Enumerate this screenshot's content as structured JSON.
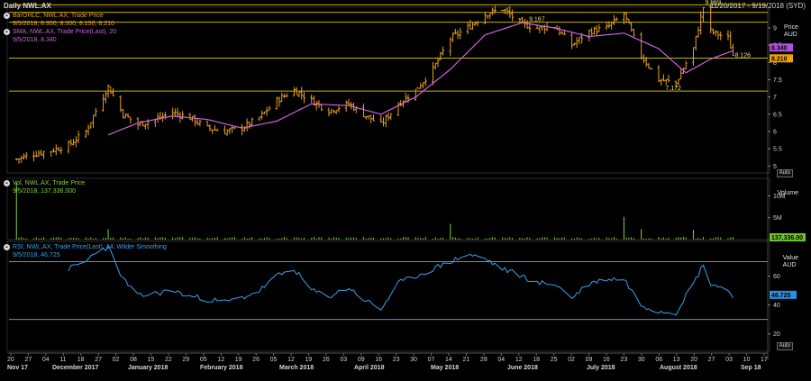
{
  "header": {
    "title": "Daily NWL.AX",
    "range": "11/20/2017 - 9/19/2018 (SYD)"
  },
  "legend": {
    "bar": {
      "name": "BarOHLC, NWL.AX, Trade Price",
      "values": "9/5/2018, 8.350, 8.500, 8.150, 8.210"
    },
    "sma": {
      "name": "SMA, NWL.AX, Trade Price(Last), 20",
      "values": "9/5/2018, 8.340"
    },
    "vol": {
      "name": "Vol, NWL.AX, Trade Price",
      "values": "9/5/2018, 137,336.000"
    },
    "rsi": {
      "name": "RSI, NWL.AX, Trade Price(Last), 14, Wilder Smoothing",
      "values": "9/5/2018, 46.725"
    }
  },
  "panels": {
    "price": {
      "unit_line1": "Price",
      "unit_line2": "AUD",
      "auto": "Auto"
    },
    "volume": {
      "unit_line1": "Volume",
      "auto": ""
    },
    "rsi": {
      "unit_line1": "Value",
      "unit_line2": "AUD",
      "auto": "Auto"
    }
  },
  "colors": {
    "bars": "#e8a020",
    "sma": "#d060e0",
    "volume": "#80d040",
    "rsi": "#3aa0e8",
    "hline": "#c8b400",
    "tag_sma": "#b050e0",
    "tag_last": "#f0a000",
    "tag_vol": "#70c030",
    "tag_rsi": "#2a90e0"
  },
  "chart_data": [
    {
      "type": "candlestick-ohlc",
      "title": "Daily NWL.AX",
      "ylabel": "Price AUD",
      "ylim": [
        4.8,
        9.6
      ],
      "y_ticks": [
        5,
        5.5,
        6,
        6.5,
        7,
        7.5,
        8,
        8.5,
        9
      ],
      "y_tick_labels": [
        "5",
        "5.5",
        "6",
        "6.5",
        "7",
        "7.5",
        "8",
        "8.5",
        "9"
      ],
      "horizontal_lines": [
        9.669,
        9.167,
        8.126,
        7.172
      ],
      "horizontal_line_extra": [
        9.45
      ],
      "annotations": [
        {
          "text": "9.669",
          "x": "2018-08-24",
          "y": 9.669
        },
        {
          "text": "9.167",
          "x": "2018-06-14",
          "y": 9.167
        },
        {
          "text": "8.126",
          "x": "2018-09-05",
          "y": 8.126
        },
        {
          "text": "7.172",
          "x": "2018-08-08",
          "y": 7.172
        }
      ],
      "last_value_tags": [
        {
          "text": "8.340",
          "value": 8.34,
          "series": "SMA"
        },
        {
          "text": "8.210",
          "value": 8.21,
          "series": "BarOHLC"
        }
      ],
      "x_ticks": [
        "20",
        "27",
        "04",
        "11",
        "18",
        "27",
        "02",
        "08",
        "15",
        "22",
        "29",
        "05",
        "12",
        "19",
        "26",
        "05",
        "12",
        "19",
        "26",
        "03",
        "09",
        "16",
        "23",
        "30",
        "07",
        "14",
        "21",
        "28",
        "04",
        "12",
        "18",
        "25",
        "02",
        "09",
        "16",
        "23",
        "30",
        "06",
        "13",
        "20",
        "27",
        "03",
        "10",
        "17"
      ],
      "x_month_labels": [
        "Nov 17",
        "December 2017",
        "January 2018",
        "February 2018",
        "March 2018",
        "April 2018",
        "May 2018",
        "June 2018",
        "July 2018",
        "August 2018",
        "Sep 18"
      ],
      "series": [
        {
          "name": "BarOHLC, NWL.AX, Trade Price",
          "close_keypoints": [
            [
              "2017-11-20",
              5.2
            ],
            [
              "2017-11-27",
              5.35
            ],
            [
              "2017-12-04",
              5.45
            ],
            [
              "2017-12-11",
              5.6
            ],
            [
              "2017-12-18",
              6.0
            ],
            [
              "2017-12-22",
              6.6
            ],
            [
              "2017-12-27",
              7.3
            ],
            [
              "2018-01-02",
              6.5
            ],
            [
              "2018-01-08",
              6.2
            ],
            [
              "2018-01-15",
              6.35
            ],
            [
              "2018-01-22",
              6.55
            ],
            [
              "2018-01-29",
              6.4
            ],
            [
              "2018-02-05",
              6.1
            ],
            [
              "2018-02-12",
              6.0
            ],
            [
              "2018-02-19",
              6.1
            ],
            [
              "2018-02-26",
              6.4
            ],
            [
              "2018-03-05",
              6.9
            ],
            [
              "2018-03-12",
              7.2
            ],
            [
              "2018-03-19",
              6.9
            ],
            [
              "2018-03-26",
              6.6
            ],
            [
              "2018-04-03",
              6.8
            ],
            [
              "2018-04-09",
              6.5
            ],
            [
              "2018-04-16",
              6.2
            ],
            [
              "2018-04-23",
              6.8
            ],
            [
              "2018-04-30",
              7.2
            ],
            [
              "2018-05-07",
              7.8
            ],
            [
              "2018-05-14",
              8.7
            ],
            [
              "2018-05-21",
              9.0
            ],
            [
              "2018-05-28",
              9.4
            ],
            [
              "2018-06-04",
              9.55
            ],
            [
              "2018-06-12",
              9.1
            ],
            [
              "2018-06-18",
              9.0
            ],
            [
              "2018-06-25",
              9.05
            ],
            [
              "2018-07-02",
              8.5
            ],
            [
              "2018-07-09",
              8.9
            ],
            [
              "2018-07-16",
              9.0
            ],
            [
              "2018-07-23",
              9.4
            ],
            [
              "2018-07-30",
              8.2
            ],
            [
              "2018-08-06",
              7.5
            ],
            [
              "2018-08-13",
              7.4
            ],
            [
              "2018-08-20",
              8.4
            ],
            [
              "2018-08-24",
              9.6
            ],
            [
              "2018-08-27",
              8.9
            ],
            [
              "2018-09-03",
              8.7
            ],
            [
              "2018-09-05",
              8.21
            ]
          ]
        },
        {
          "name": "SMA, NWL.AX, Trade Price(Last), 20",
          "keypoints": [
            [
              "2017-12-27",
              5.9
            ],
            [
              "2018-01-08",
              6.25
            ],
            [
              "2018-01-22",
              6.45
            ],
            [
              "2018-02-05",
              6.35
            ],
            [
              "2018-02-19",
              6.1
            ],
            [
              "2018-03-05",
              6.3
            ],
            [
              "2018-03-19",
              6.8
            ],
            [
              "2018-04-03",
              6.75
            ],
            [
              "2018-04-16",
              6.5
            ],
            [
              "2018-04-30",
              7.0
            ],
            [
              "2018-05-14",
              7.8
            ],
            [
              "2018-05-28",
              8.8
            ],
            [
              "2018-06-12",
              9.15
            ],
            [
              "2018-06-25",
              9.0
            ],
            [
              "2018-07-09",
              8.75
            ],
            [
              "2018-07-23",
              8.85
            ],
            [
              "2018-08-06",
              8.4
            ],
            [
              "2018-08-17",
              7.7
            ],
            [
              "2018-08-27",
              8.1
            ],
            [
              "2018-09-05",
              8.34
            ]
          ]
        }
      ]
    },
    {
      "type": "bar",
      "title": "Vol, NWL.AX, Trade Price",
      "ylabel": "Volume",
      "y_ticks": [
        5000000,
        10000000
      ],
      "y_tick_labels": [
        "5M",
        "10M"
      ],
      "ylim": [
        0,
        14000000
      ],
      "last_value_tag": "137,336.00",
      "spikes": [
        [
          "2017-11-20",
          13000000
        ],
        [
          "2017-12-27",
          2400000
        ],
        [
          "2018-05-14",
          3600000
        ],
        [
          "2018-07-23",
          5200000
        ],
        [
          "2018-07-30",
          2400000
        ],
        [
          "2018-08-20",
          2200000
        ]
      ],
      "typical_volume": 400000
    },
    {
      "type": "line",
      "title": "RSI, NWL.AX, Trade Price(Last), 14, Wilder Smoothing",
      "ylabel": "Value AUD",
      "ylim": [
        8,
        84
      ],
      "y_ticks": [
        20,
        40,
        60
      ],
      "y_tick_labels": [
        "20",
        "40",
        "60"
      ],
      "horizontal_lines": [
        70,
        30
      ],
      "last_value_tag": "46.725",
      "series": [
        {
          "name": "RSI, NWL.AX, Trade Price(Last), 14, Wilder Smoothing",
          "keypoints": [
            [
              "2017-12-11",
              65
            ],
            [
              "2017-12-18",
              70
            ],
            [
              "2017-12-22",
              77
            ],
            [
              "2017-12-27",
              80
            ],
            [
              "2018-01-02",
              58
            ],
            [
              "2018-01-08",
              46
            ],
            [
              "2018-01-15",
              48
            ],
            [
              "2018-01-22",
              50
            ],
            [
              "2018-01-29",
              46
            ],
            [
              "2018-02-05",
              44
            ],
            [
              "2018-02-12",
              42
            ],
            [
              "2018-02-19",
              45
            ],
            [
              "2018-02-26",
              50
            ],
            [
              "2018-03-05",
              60
            ],
            [
              "2018-03-12",
              65
            ],
            [
              "2018-03-19",
              50
            ],
            [
              "2018-03-26",
              46
            ],
            [
              "2018-04-03",
              52
            ],
            [
              "2018-04-09",
              44
            ],
            [
              "2018-04-16",
              37
            ],
            [
              "2018-04-23",
              55
            ],
            [
              "2018-04-30",
              60
            ],
            [
              "2018-05-07",
              65
            ],
            [
              "2018-05-14",
              70
            ],
            [
              "2018-05-21",
              75
            ],
            [
              "2018-05-28",
              72
            ],
            [
              "2018-06-04",
              65
            ],
            [
              "2018-06-12",
              60
            ],
            [
              "2018-06-18",
              55
            ],
            [
              "2018-06-25",
              55
            ],
            [
              "2018-07-02",
              45
            ],
            [
              "2018-07-09",
              55
            ],
            [
              "2018-07-16",
              58
            ],
            [
              "2018-07-23",
              58
            ],
            [
              "2018-07-30",
              40
            ],
            [
              "2018-08-06",
              36
            ],
            [
              "2018-08-13",
              35
            ],
            [
              "2018-08-20",
              55
            ],
            [
              "2018-08-24",
              68
            ],
            [
              "2018-08-27",
              55
            ],
            [
              "2018-09-03",
              50
            ],
            [
              "2018-09-05",
              46.725
            ]
          ]
        }
      ]
    }
  ]
}
